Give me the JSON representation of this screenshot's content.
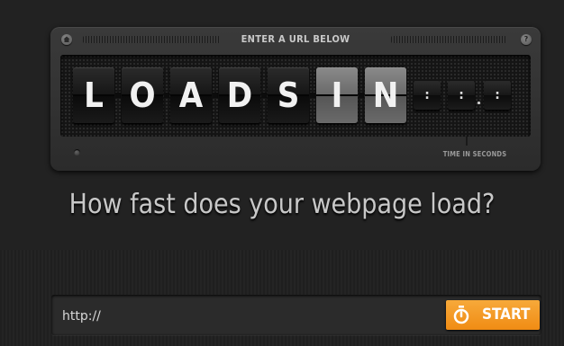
{
  "panel": {
    "title": "ENTER A URL BELOW",
    "help_symbol": "?",
    "tiles": [
      "L",
      "O",
      "A",
      "D",
      "S",
      "I",
      "N"
    ],
    "small_tiles": [
      ":",
      ":",
      ":"
    ],
    "time_label": "TIME IN SECONDS"
  },
  "headline": "How fast does your webpage load?",
  "url_form": {
    "placeholder": "http://",
    "start_label": "START"
  },
  "colors": {
    "accent": "#f39b22",
    "background": "#222222"
  }
}
